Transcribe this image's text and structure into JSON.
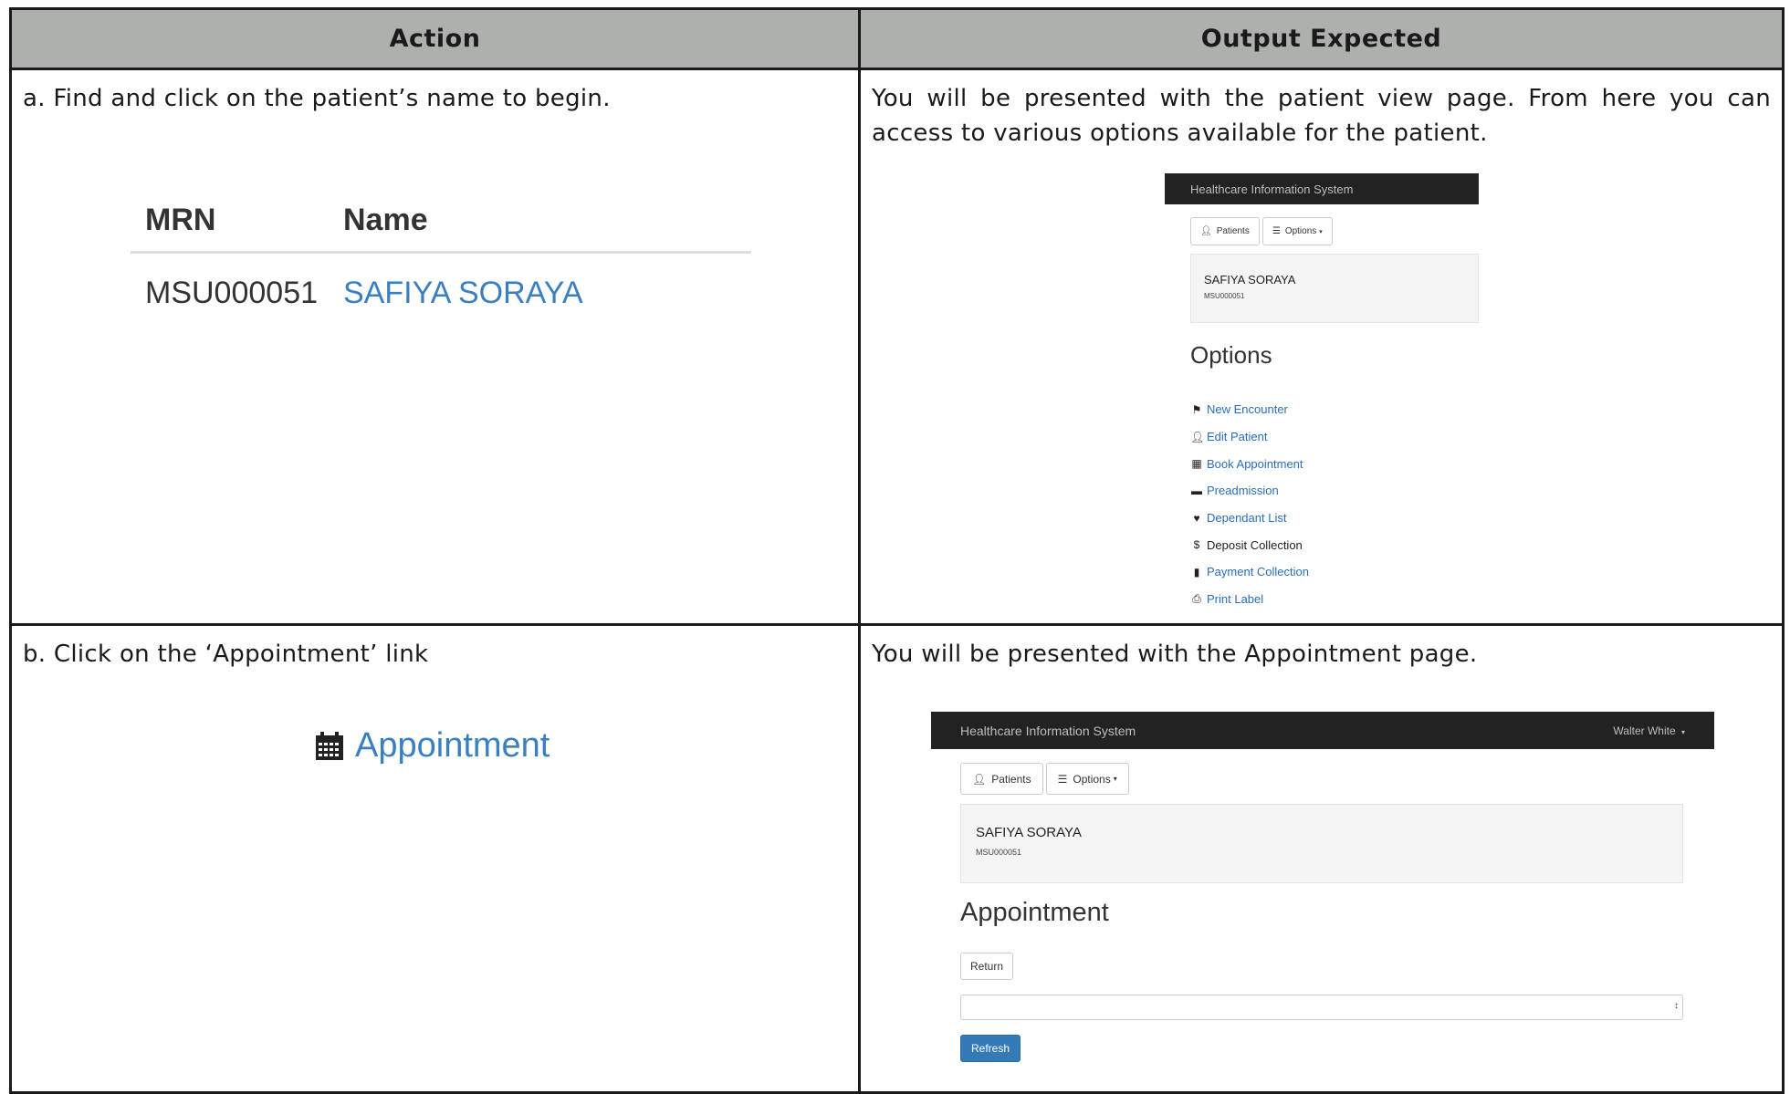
{
  "table": {
    "headers": {
      "action": "Action",
      "output": "Output Expected"
    },
    "rows": [
      {
        "action_text": "a. Find and click on the patient’s name to begin.",
        "output_text": "You will be presented with the patient view page. From here you can access to various options available for the patient.",
        "mini_table": {
          "col_mrn": "MRN",
          "col_name": "Name",
          "mrn": "MSU000051",
          "name": "SAFIYA SORAYA"
        },
        "screenshot": {
          "app_title": "Healthcare Information System",
          "patients_button": "Patients",
          "options_button": "Options",
          "patient_name": "SAFIYA SORAYA",
          "patient_mrn": "MSU000051",
          "options_heading": "Options",
          "options": [
            {
              "label": "New Encounter",
              "icon": "flag-icon"
            },
            {
              "label": "Edit Patient",
              "icon": "user-icon"
            },
            {
              "label": "Book Appointment",
              "icon": "calendar-icon"
            },
            {
              "label": "Preadmission",
              "icon": "bed-icon"
            },
            {
              "label": "Dependant List",
              "icon": "heart-icon"
            },
            {
              "label": "Deposit Collection",
              "icon": "dollar-icon"
            },
            {
              "label": "Payment Collection",
              "icon": "book-icon"
            },
            {
              "label": "Print Label",
              "icon": "print-icon"
            }
          ]
        }
      },
      {
        "action_text": "b. Click on the ‘Appointment’ link",
        "output_text": "You will be presented with the Appointment page.",
        "link_label": "Appointment",
        "screenshot": {
          "app_title": "Healthcare Information System",
          "user_menu": "Walter White",
          "patients_button": "Patients",
          "options_button": "Options",
          "patient_name": "SAFIYA SORAYA",
          "patient_mrn": "MSU000051",
          "page_title": "Appointment",
          "return_button": "Return",
          "refresh_button": "Refresh"
        }
      }
    ]
  },
  "colors": {
    "header_bg": "#aeb0ae",
    "link": "#3a7fc1",
    "navbar": "#222222",
    "primary_button": "#337ab7"
  }
}
